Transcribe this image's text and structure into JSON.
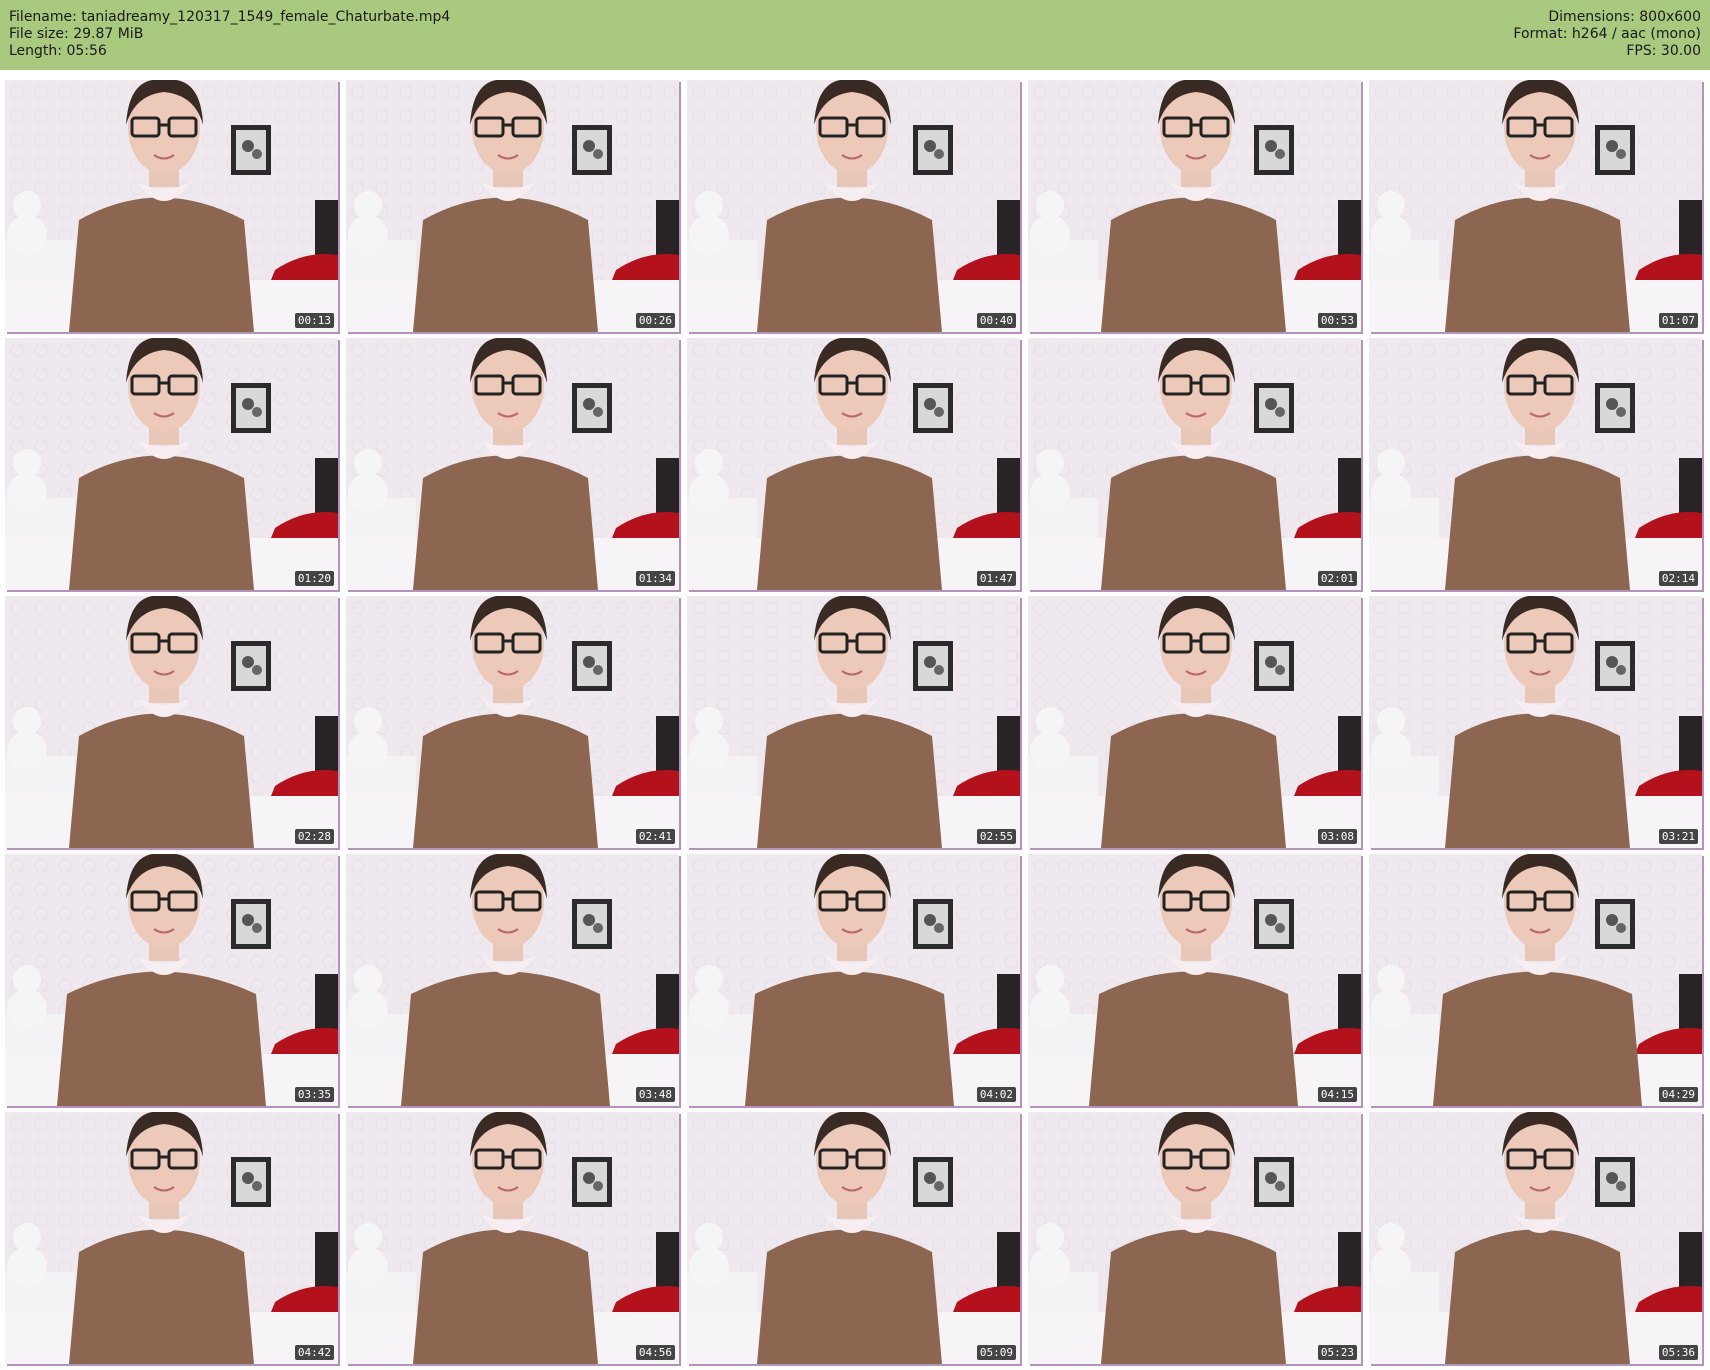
{
  "header": {
    "filename": "Filename: taniadreamy_120317_1549_female_Chaturbate.mp4",
    "filesize": "File size: 29.87 MiB",
    "length": "Length: 05:56",
    "dimensions": "Dimensions: 800x600",
    "format": "Format: h264 / aac (mono)",
    "fps": "FPS: 30.00"
  },
  "colors": {
    "header_bg": "#a9c97f",
    "thumb_border": "#b592b9",
    "dress": "#8c6650",
    "wall": "#eee9ef"
  },
  "thumbnails": [
    {
      "timestamp": "00:13"
    },
    {
      "timestamp": "00:26"
    },
    {
      "timestamp": "00:40"
    },
    {
      "timestamp": "00:53"
    },
    {
      "timestamp": "01:07"
    },
    {
      "timestamp": "01:20"
    },
    {
      "timestamp": "01:34"
    },
    {
      "timestamp": "01:47"
    },
    {
      "timestamp": "02:01"
    },
    {
      "timestamp": "02:14"
    },
    {
      "timestamp": "02:28"
    },
    {
      "timestamp": "02:41"
    },
    {
      "timestamp": "02:55"
    },
    {
      "timestamp": "03:08"
    },
    {
      "timestamp": "03:21"
    },
    {
      "timestamp": "03:35"
    },
    {
      "timestamp": "03:48"
    },
    {
      "timestamp": "04:02"
    },
    {
      "timestamp": "04:15"
    },
    {
      "timestamp": "04:29"
    },
    {
      "timestamp": "04:42"
    },
    {
      "timestamp": "04:56"
    },
    {
      "timestamp": "05:09"
    },
    {
      "timestamp": "05:23"
    },
    {
      "timestamp": "05:36"
    }
  ]
}
